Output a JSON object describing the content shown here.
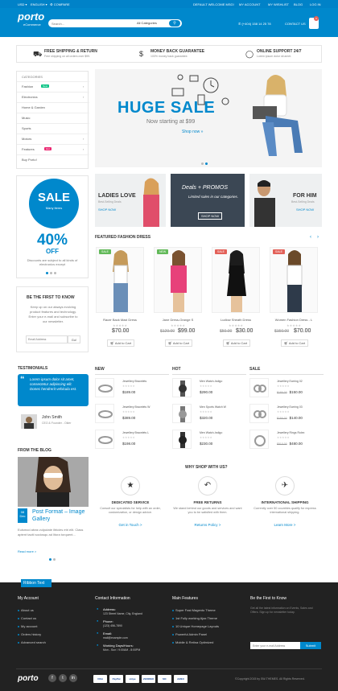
{
  "topbar": {
    "currency": "USD ▾",
    "language": "ENGLISH ▾",
    "compare": "♻ COMPARE",
    "welcome": "DEFAULT WELCOME MSG!",
    "account": "MY ACCOUNT",
    "wishlist": "MY WISHLIST",
    "blog": "BLOG",
    "login": "LOG IN"
  },
  "header": {
    "logo": "porto",
    "logo_sub": "eCommerce",
    "search_placeholder": "Search...",
    "category": "All Categories",
    "phone": "(+404) 158 14 25 78",
    "contact": "CONTACT US",
    "cart_count": "0"
  },
  "features": [
    {
      "title": "FREE SHIPPING & RETURN",
      "sub": "Free shipping on all orders over $99."
    },
    {
      "title": "MONEY BACK GUARANTEE",
      "sub": "100% money back guarantee."
    },
    {
      "title": "ONLINE SUPPORT 24/7",
      "sub": "Lorem ipsum dolor sit amet."
    }
  ],
  "categories": {
    "title": "CATEGORIES",
    "items": [
      {
        "label": "Fashion",
        "badge": "new"
      },
      {
        "label": "Electronics",
        "badge": ""
      },
      {
        "label": "Home & Garden",
        "badge": ""
      },
      {
        "label": "Music",
        "badge": ""
      },
      {
        "label": "Sports",
        "badge": ""
      },
      {
        "label": "Motors",
        "badge": ""
      },
      {
        "label": "Features",
        "badge": "hot"
      },
      {
        "label": "Buy Porto!",
        "badge": ""
      }
    ],
    "new_label": "New",
    "hot_label": "Hot"
  },
  "hero": {
    "title": "HUGE SALE",
    "sub": "Now starting at $99",
    "button": "Shop now »"
  },
  "sale": {
    "big": "SALE",
    "small": "Many items",
    "pct": "40%",
    "off": "OFF",
    "desc": "Discounts are subject to all kinds of electronics except"
  },
  "promos": [
    {
      "t1": "LADIES LOVE",
      "t2": "Best-Selling Deals",
      "t3": "SHOP NOW"
    },
    {
      "t1": "Deals + PROMOS",
      "t2": "Limited sales in our categories.",
      "t3": "SHOP NOW"
    },
    {
      "t1": "FOR HIM",
      "t2": "Best-Selling Deals",
      "t3": "SHOP NOW"
    }
  ],
  "newsletter": {
    "title": "BE THE FIRST TO KNOW",
    "text": "Keep up on our always evolving product features and technology. Enter your e-mail and subscribe to our newsletter.",
    "placeholder": "Email Address",
    "button": "Go!"
  },
  "featured": {
    "title": "FEATURED FASHION DRESS",
    "cart_label": "Add to Cart",
    "stars": "★★★★★",
    "items": [
      {
        "tag": "SALE",
        "tag_color": "#62b959",
        "name": "Racer Back Maxi Dress",
        "old": "",
        "price": "$70.00"
      },
      {
        "tag": "NEW",
        "tag_color": "#62b959",
        "name": "Jane Dress-Orange S",
        "old": "$129.00",
        "price": "$99.00"
      },
      {
        "tag": "SALE",
        "tag_color": "#e36159",
        "name": "Ludlow Sheath Dress",
        "old": "$50.00",
        "price": "$30.00"
      },
      {
        "tag": "SALE",
        "tag_color": "#e36159",
        "name": "Women Fashion Dress - L",
        "old": "$150.00",
        "price": "$70.00"
      }
    ]
  },
  "lists": [
    {
      "title": "NEW",
      "items": [
        {
          "name": "Jewellery Bracelets",
          "old": "",
          "price": "$189.00"
        },
        {
          "name": "Jewellery Bracelets W",
          "old": "",
          "price": "$389.00"
        },
        {
          "name": "Jewellery Bracelets L",
          "old": "",
          "price": "$198.00"
        }
      ]
    },
    {
      "title": "HOT",
      "items": [
        {
          "name": "Men Watch-Indigo",
          "old": "",
          "price": "$290.00"
        },
        {
          "name": "Men Sports Watch W",
          "old": "",
          "price": "$320.00"
        },
        {
          "name": "Men Watch-Indigo",
          "old": "",
          "price": "$230.00"
        }
      ]
    },
    {
      "title": "SALE",
      "items": [
        {
          "name": "Jewellery Earring 02",
          "old": "$180.00",
          "price": "$150.00"
        },
        {
          "name": "Jewellery Earring 03",
          "old": "$150.00",
          "price": "$140.00"
        },
        {
          "name": "Jewellery Rings Rolex",
          "old": "$510.00",
          "price": "$480.00"
        }
      ]
    }
  ],
  "testimonials": {
    "title": "TESTIMONIALS",
    "quote": "Lorem ipsum dolor sit amet, consectetur adipiscing elit. Donec hendrerit vehicula est.",
    "name": "John Smith",
    "role": "CEO & Founder - Okler"
  },
  "why": {
    "title": "WHY SHOP WITH US?",
    "services": [
      {
        "icon": "★",
        "title": "DEDICATED SERVICE",
        "desc": "Consult our specialists for help with an order, customization, or design advice.",
        "link": "Get in Touch >"
      },
      {
        "icon": "↶",
        "title": "FREE RETURNS",
        "desc": "We stand behind our goods and services and want you to be satisfied with them.",
        "link": "Returns Policy >"
      },
      {
        "icon": "✈",
        "title": "INTERNATIONAL SHIPPING",
        "desc": "Currently over 50 countries qualify for express international shipping.",
        "link": "Learn More >"
      }
    ]
  },
  "blog": {
    "title": "FROM THE BLOG",
    "day": "08",
    "month": "Dec",
    "post_title": "Post Format – Image Gallery",
    "text": "Euismod atras vulputate iltricies etri elit. Class aptent taciti sociosqu ad litora torquent...",
    "more": "Read more >"
  },
  "footer": {
    "ribbon": "Ribbon Text",
    "account": {
      "title": "My Account",
      "items": [
        "About us",
        "Contact us",
        "My account",
        "Orders history",
        "Advanced search"
      ]
    },
    "contact": {
      "title": "Contact Information",
      "address_label": "Address:",
      "address": "123 Street Name, City, England",
      "phone_label": "Phone:",
      "phone": "(123) 456-7890",
      "email_label": "Email:",
      "email": "mail@example.com",
      "hours_label": "Working Days/Hours:",
      "hours": "Mon - Sun / 9:00AM - 8:00PM"
    },
    "features": {
      "title": "Main Features",
      "items": [
        "Super Fast Magento Theme",
        "1st Fully working Ajax Theme",
        "10 Unique Homepage Layouts",
        "Powerful Admin Panel",
        "Mobile & Retina Optimized"
      ]
    },
    "news": {
      "title": "Be the First to Know",
      "text": "Get all the latest information on Events, Sales and Offers. Sign up for newsletter today.",
      "placeholder": "Enter your e-mail Address",
      "button": "Submit"
    },
    "logo": "porto",
    "socials": [
      "f",
      "t",
      "in"
    ],
    "payments": [
      "VISA",
      "PayPal",
      "stripe",
      "VERIFIED",
      "MC",
      "AMEX"
    ],
    "copyright": "©Copyright 2015 by SW-THEMES. All Rights Reserved."
  }
}
